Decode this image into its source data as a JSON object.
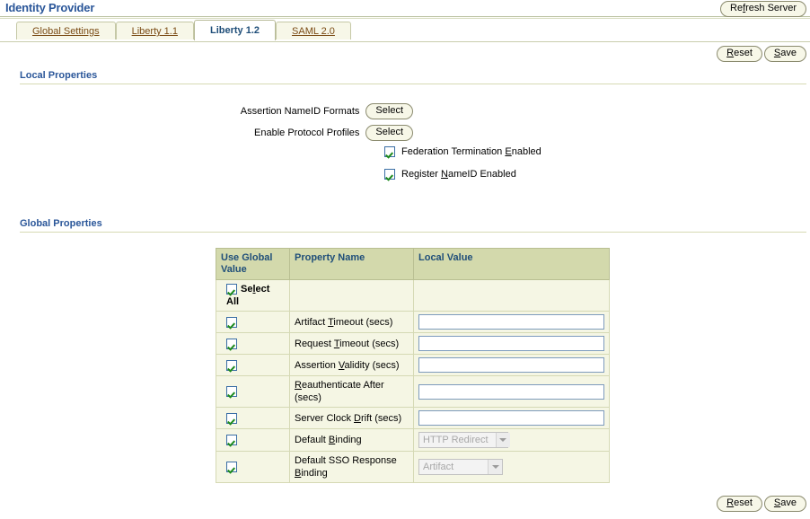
{
  "header": {
    "title": "Identity Provider",
    "refresh_button": "Refresh Server"
  },
  "tabs": [
    {
      "label": "Global Settings",
      "active": false
    },
    {
      "label": "Liberty 1.1",
      "active": false
    },
    {
      "label": "Liberty 1.2",
      "active": true
    },
    {
      "label": "SAML 2.0",
      "active": false
    }
  ],
  "buttons": {
    "reset": "Reset",
    "save": "Save",
    "select": "Select"
  },
  "local_properties": {
    "section_title": "Local Properties",
    "rows": [
      {
        "label": "Assertion NameID Formats",
        "control": "button"
      },
      {
        "label": "Enable Protocol Profiles",
        "control": "button"
      }
    ],
    "checkboxes": [
      {
        "label_pre": "Federation Termination ",
        "label_key": "E",
        "label_post": "nabled",
        "checked": true
      },
      {
        "label_pre": "Register ",
        "label_key": "N",
        "label_post": "ameID Enabled",
        "checked": true
      }
    ]
  },
  "global_properties": {
    "section_title": "Global Properties",
    "columns": [
      "Use Global Value",
      "Property Name",
      "Local Value"
    ],
    "select_all": {
      "label": "Select All",
      "checked": true
    },
    "rows": [
      {
        "use_global": true,
        "pre": "Artifact ",
        "key": "T",
        "post": "imeout (secs)",
        "type": "text",
        "value": ""
      },
      {
        "use_global": true,
        "pre": "Request ",
        "key": "T",
        "post": "imeout (secs)",
        "type": "text",
        "value": ""
      },
      {
        "use_global": true,
        "pre": "Assertion ",
        "key": "V",
        "post": "alidity (secs)",
        "type": "text",
        "value": ""
      },
      {
        "use_global": true,
        "pre": "",
        "key": "R",
        "post": "eauthenticate After (secs)",
        "type": "text",
        "value": ""
      },
      {
        "use_global": true,
        "pre": "Server Clock ",
        "key": "D",
        "post": "rift (secs)",
        "type": "text",
        "value": ""
      },
      {
        "use_global": true,
        "pre": "Default ",
        "key": "B",
        "post": "inding",
        "type": "select",
        "value": "HTTP Redirect",
        "width": "sel-w1"
      },
      {
        "use_global": true,
        "pre": "Default SSO Response ",
        "key": "B",
        "post": "inding",
        "type": "select",
        "value": "Artifact",
        "width": "sel-w2"
      }
    ]
  },
  "colors": {
    "title_blue": "#2a5699",
    "tab_link_brown": "#7a4a13",
    "table_header_bg": "#d3d9ac",
    "table_row_bg": "#f5f6e4",
    "check_green": "#1d8a1d",
    "button_bg": "#f7f7e8"
  }
}
